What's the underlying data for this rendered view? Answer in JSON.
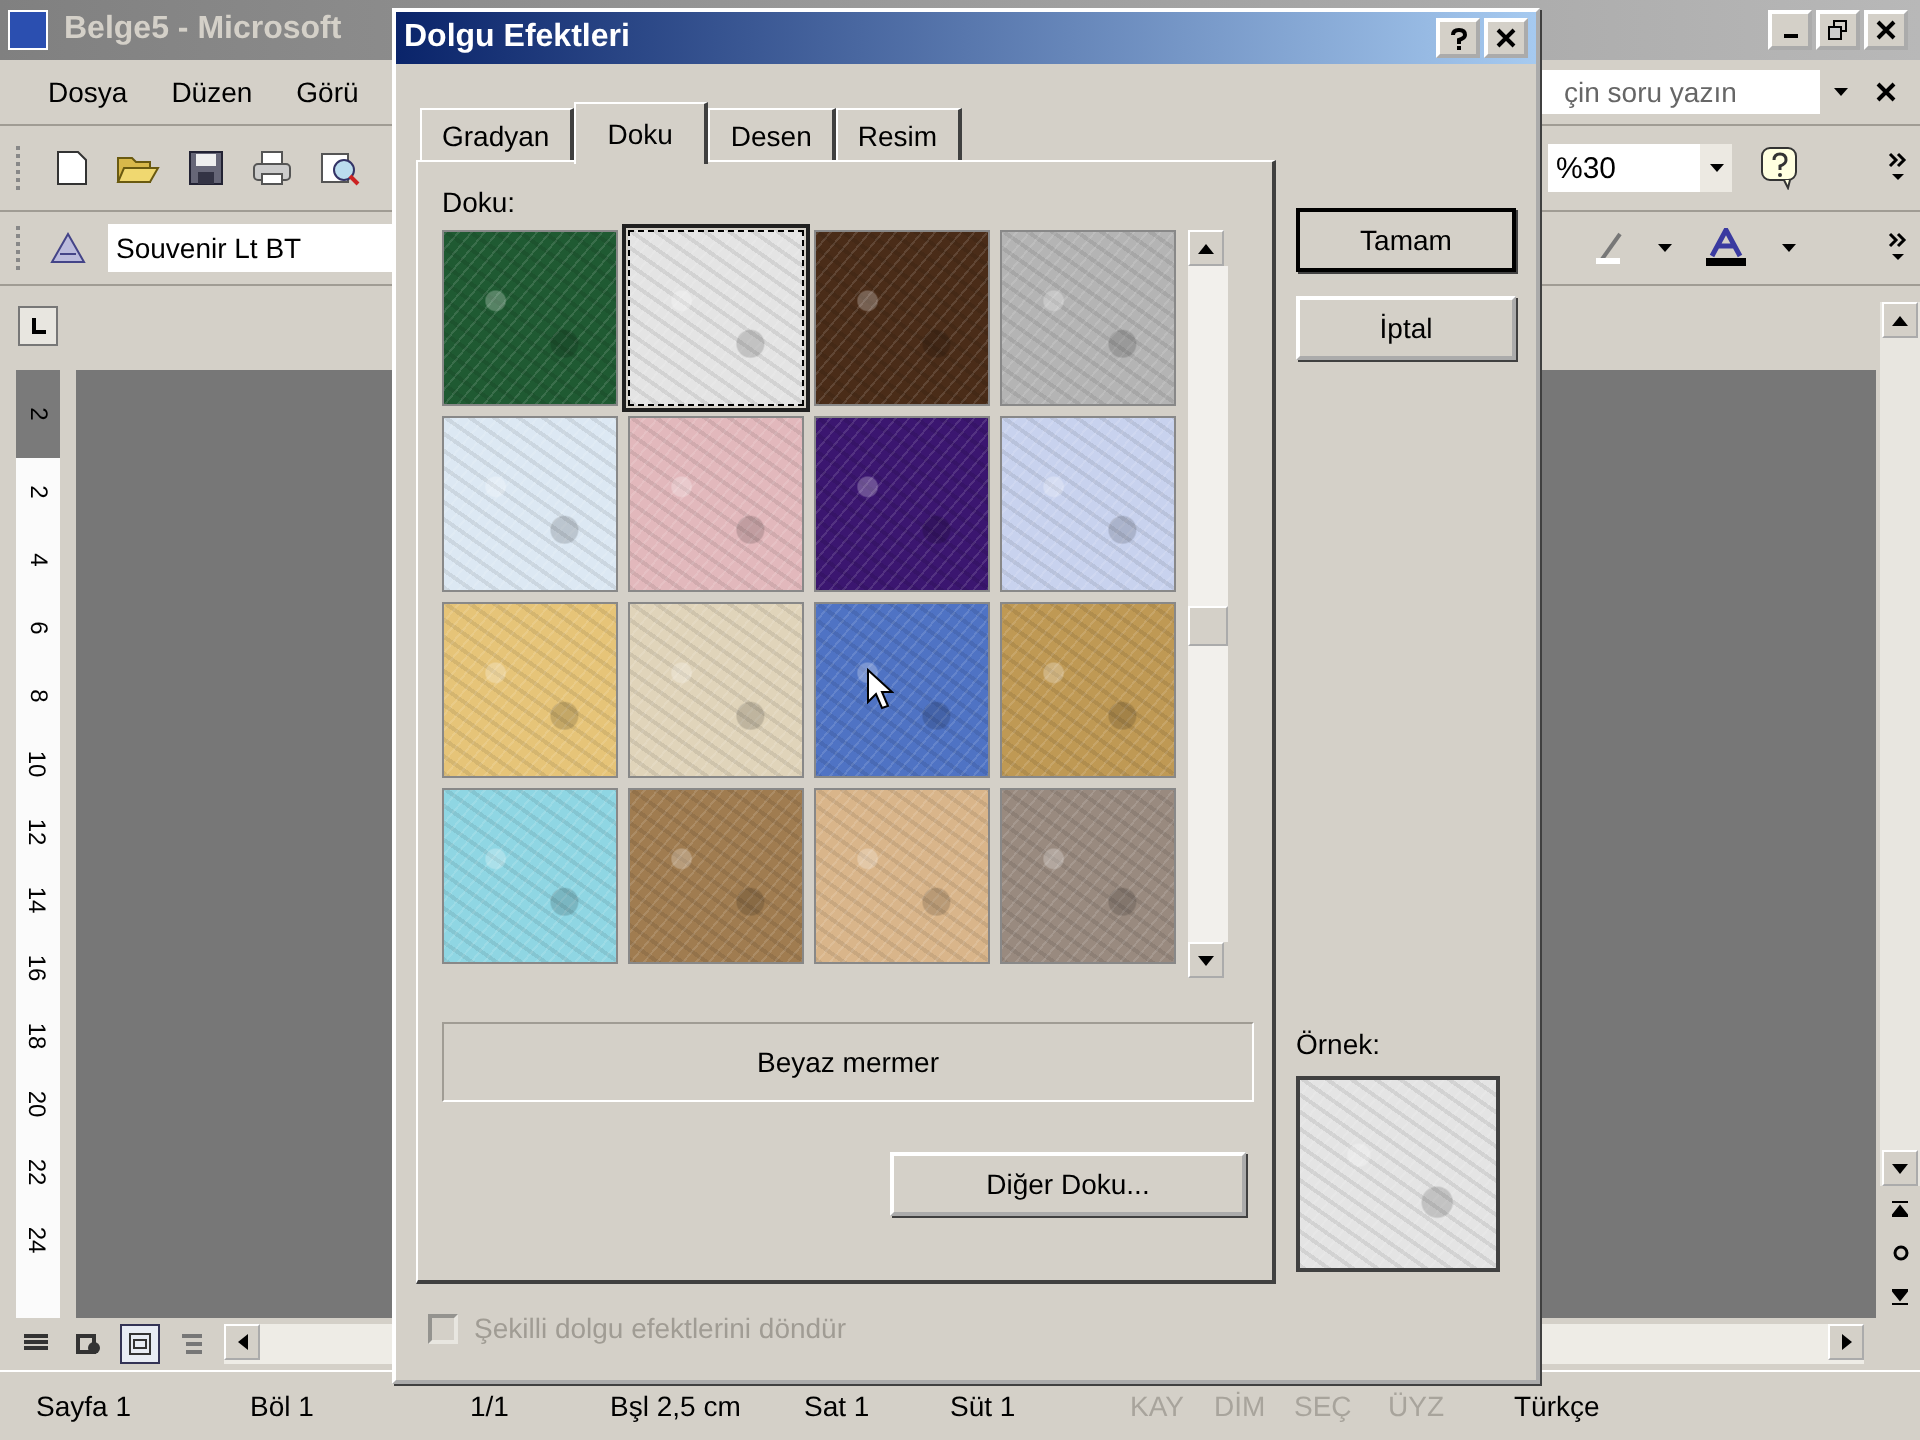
{
  "word_window": {
    "title": "Belge5 - Microsoft",
    "menu": [
      "Dosya",
      "Düzen",
      "Görü"
    ],
    "question_field": {
      "placeholder": "çin soru yazın"
    },
    "zoom": "%30",
    "font_field": "Souvenir Lt BT",
    "ruler": [
      {
        "label": "2",
        "margin": true
      },
      {
        "label": "2",
        "margin": false
      },
      {
        "label": "4",
        "margin": false
      },
      {
        "label": "6",
        "margin": false
      },
      {
        "label": "8",
        "margin": false
      },
      {
        "label": "10",
        "margin": false
      },
      {
        "label": "12",
        "margin": false
      },
      {
        "label": "14",
        "margin": false
      },
      {
        "label": "16",
        "margin": false
      },
      {
        "label": "18",
        "margin": false
      },
      {
        "label": "20",
        "margin": false
      },
      {
        "label": "22",
        "margin": false
      },
      {
        "label": "24",
        "margin": false
      }
    ],
    "status_bar": [
      {
        "text": "Sayfa 1",
        "disabled": false
      },
      {
        "text": "Böl 1",
        "disabled": false
      },
      {
        "text": "1/1",
        "disabled": false
      },
      {
        "text": "Bşl 2,5 cm",
        "disabled": false
      },
      {
        "text": "Sat 1",
        "disabled": false
      },
      {
        "text": "Süt 1",
        "disabled": false
      },
      {
        "text": "KAY",
        "disabled": true
      },
      {
        "text": "DİM",
        "disabled": true
      },
      {
        "text": "SEÇ",
        "disabled": true
      },
      {
        "text": "ÜYZ",
        "disabled": true
      },
      {
        "text": "Türkçe",
        "disabled": false
      }
    ]
  },
  "dialog": {
    "title": "Dolgu Efektleri",
    "tabs": [
      {
        "label": "Gradyan",
        "selected": false
      },
      {
        "label": "Doku",
        "selected": true
      },
      {
        "label": "Desen",
        "selected": false
      },
      {
        "label": "Resim",
        "selected": false
      }
    ],
    "texture_label": "Doku:",
    "textures": [
      {
        "color": "#1f5a32",
        "selected": false
      },
      {
        "color": "#e4e4e4",
        "selected": true
      },
      {
        "color": "#4a2c18",
        "selected": false
      },
      {
        "color": "#b4b4b4",
        "selected": false
      },
      {
        "color": "#dce8f3",
        "selected": false
      },
      {
        "color": "#e2b8bc",
        "selected": false
      },
      {
        "color": "#3b1670",
        "selected": false
      },
      {
        "color": "#c8d2ee",
        "selected": false
      },
      {
        "color": "#e6c478",
        "selected": false
      },
      {
        "color": "#e0d4ba",
        "selected": false
      },
      {
        "color": "#4f73c4",
        "selected": false
      },
      {
        "color": "#bf9954",
        "selected": false
      },
      {
        "color": "#8fd6e3",
        "selected": false
      },
      {
        "color": "#a07c50",
        "selected": false
      },
      {
        "color": "#d9b58a",
        "selected": false
      },
      {
        "color": "#998a7f",
        "selected": false
      }
    ],
    "texture_name": "Beyaz mermer",
    "more_button": "Diğer Doku...",
    "buttons": [
      "Tamam",
      "İptal"
    ],
    "preview_label": "Örnek:",
    "rotate_checkbox": {
      "label": "Şekilli dolgu efektlerini döndür",
      "checked": false,
      "disabled": true
    }
  }
}
